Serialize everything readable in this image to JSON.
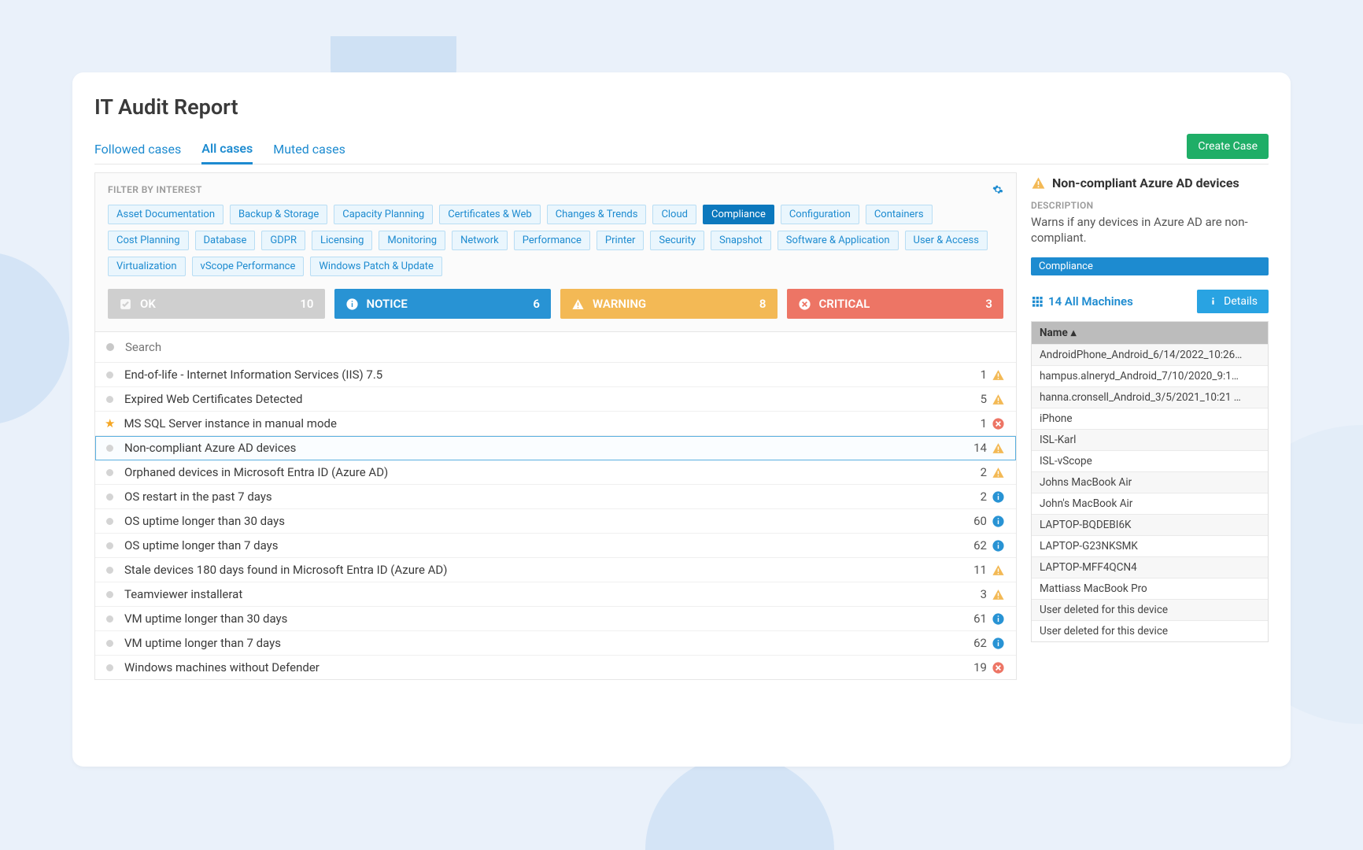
{
  "title": "IT Audit Report",
  "tabs": {
    "followed": "Followed cases",
    "all": "All cases",
    "muted": "Muted cases"
  },
  "create": "Create Case",
  "filterTitle": "FILTER BY INTEREST",
  "chips": [
    "Asset Documentation",
    "Backup & Storage",
    "Capacity Planning",
    "Certificates & Web",
    "Changes & Trends",
    "Cloud",
    "Compliance",
    "Configuration",
    "Containers",
    "Cost Planning",
    "Database",
    "GDPR",
    "Licensing",
    "Monitoring",
    "Network",
    "Performance",
    "Printer",
    "Security",
    "Snapshot",
    "Software & Application",
    "User & Access",
    "Virtualization",
    "vScope Performance",
    "Windows Patch & Update"
  ],
  "activeChip": "Compliance",
  "sev": {
    "ok": {
      "label": "OK",
      "count": "10"
    },
    "notice": {
      "label": "NOTICE",
      "count": "6"
    },
    "warning": {
      "label": "WARNING",
      "count": "8"
    },
    "critical": {
      "label": "CRITICAL",
      "count": "3"
    }
  },
  "searchPlaceholder": "Search",
  "rows": [
    {
      "label": "End-of-life - Internet Information Services (IIS) 7.5",
      "count": "1",
      "sev": "warning"
    },
    {
      "label": "Expired Web Certificates Detected",
      "count": "5",
      "sev": "warning"
    },
    {
      "label": "MS SQL Server instance in manual mode",
      "count": "1",
      "sev": "critical",
      "star": true
    },
    {
      "label": "Non-compliant Azure AD devices",
      "count": "14",
      "sev": "warning",
      "selected": true
    },
    {
      "label": "Orphaned devices in Microsoft Entra ID (Azure AD)",
      "count": "2",
      "sev": "warning"
    },
    {
      "label": "OS restart in the past 7 days",
      "count": "2",
      "sev": "notice"
    },
    {
      "label": "OS uptime longer than 30 days",
      "count": "60",
      "sev": "notice"
    },
    {
      "label": "OS uptime longer than 7 days",
      "count": "62",
      "sev": "notice"
    },
    {
      "label": "Stale devices 180 days found in Microsoft Entra ID (Azure AD)",
      "count": "11",
      "sev": "warning"
    },
    {
      "label": "Teamviewer installerat",
      "count": "3",
      "sev": "warning"
    },
    {
      "label": "VM uptime longer than 30 days",
      "count": "61",
      "sev": "notice"
    },
    {
      "label": "VM uptime longer than 7 days",
      "count": "62",
      "sev": "notice"
    },
    {
      "label": "Windows machines without Defender",
      "count": "19",
      "sev": "critical"
    }
  ],
  "detail": {
    "title": "Non-compliant Azure AD devices",
    "descLabel": "DESCRIPTION",
    "desc": "Warns if any devices in Azure AD are non-compliant.",
    "tag": "Compliance",
    "link": "14 All Machines",
    "button": "Details",
    "col": "Name",
    "machines": [
      "AndroidPhone_Android_6/14/2022_10:26…",
      "hampus.alneryd_Android_7/10/2020_9:1…",
      "hanna.cronsell_Android_3/5/2021_10:21 …",
      "iPhone",
      "ISL-Karl",
      "ISL-vScope",
      "Johns MacBook Air",
      "John's MacBook Air",
      "LAPTOP-BQDEBI6K",
      "LAPTOP-G23NKSMK",
      "LAPTOP-MFF4QCN4",
      "Mattiass MacBook Pro",
      "User deleted for this device",
      "User deleted for this device"
    ]
  }
}
